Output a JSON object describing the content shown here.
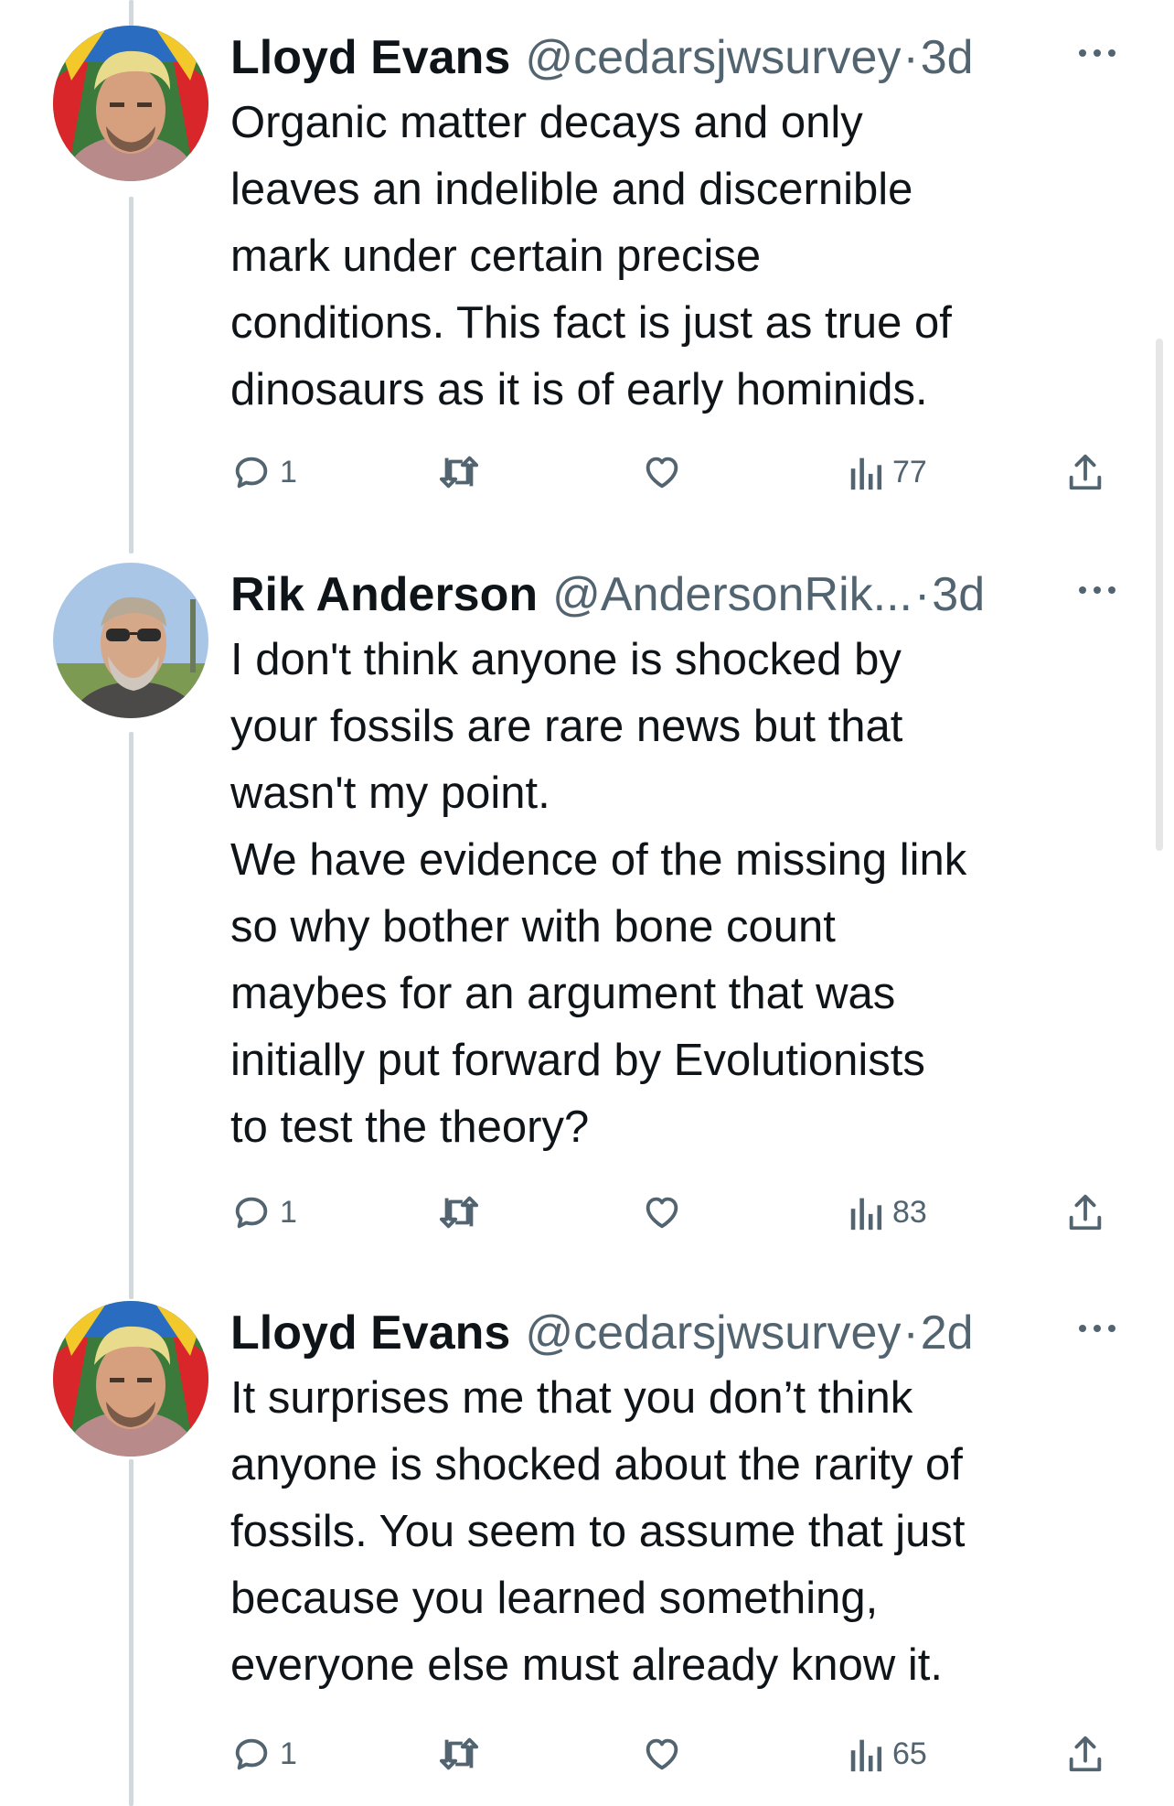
{
  "tweets": [
    {
      "name": "Lloyd Evans",
      "handle": "@cedarsjwsurvey",
      "separator": "·",
      "time": "3d",
      "text": "Organic matter decays and only\nleaves an indelible and discernible\nmark under certain precise\nconditions. This fact is just as true of\ndinosaurs as it is of early hominids.",
      "replies": "1",
      "views": "77",
      "avatar": "lloyd-evans-avatar"
    },
    {
      "name": "Rik Anderson",
      "handle": "@AndersonRik...",
      "separator": "·",
      "time": "3d",
      "text": "I don't think anyone is shocked by\nyour fossils are rare news but that\nwasn't my point.\nWe have evidence of the missing link\nso why bother with bone count\nmaybes for an argument that was\ninitially put forward by Evolutionists\nto test the theory?",
      "replies": "1",
      "views": "83",
      "avatar": "rik-anderson-avatar"
    },
    {
      "name": "Lloyd Evans",
      "handle": "@cedarsjwsurvey",
      "separator": "·",
      "time": "2d",
      "text": "It surprises me that you don’t think\nanyone is shocked about the rarity of\nfossils. You seem to assume that just\nbecause you learned something,\neveryone else must already know it.",
      "replies": "1",
      "views": "65",
      "avatar": "lloyd-evans-avatar"
    }
  ],
  "colors": {
    "text_primary": "#0f1419",
    "text_secondary": "#536471",
    "thread_line": "#cfd9de"
  },
  "icons": {
    "reply": "reply-icon",
    "retweet": "retweet-icon",
    "like": "like-icon",
    "views": "views-icon",
    "share": "share-icon",
    "more": "more-icon"
  }
}
